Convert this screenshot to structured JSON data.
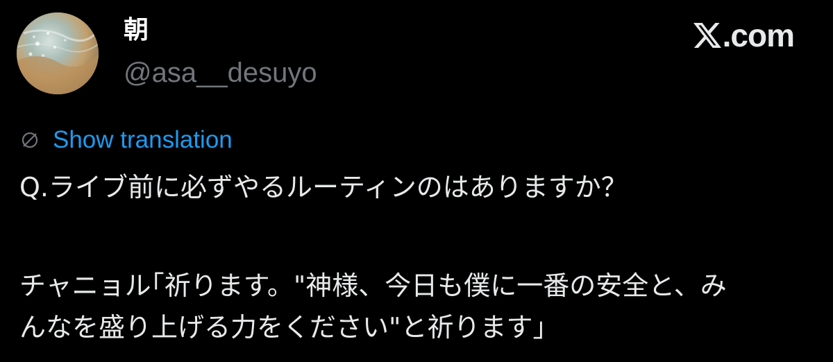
{
  "author": {
    "display_name": "朝",
    "handle": "@asa__desuyo"
  },
  "brand": {
    "label": ".com",
    "icon": "x-logo-icon"
  },
  "translation": {
    "label": "Show translation",
    "icon": "globe-icon"
  },
  "tweet": {
    "lines": [
      "Q.ライブ前に必ずやるルーティンのはありますか？",
      "チャニョル｢祈ります。\"神様、今日も僕に一番の安全と、み",
      "んなを盛り上げる力をください\"と祈ります｣"
    ]
  },
  "colors": {
    "background": "#000000",
    "text": "#e7e9ea",
    "secondary": "#71767b",
    "link": "#1d9bf0"
  }
}
